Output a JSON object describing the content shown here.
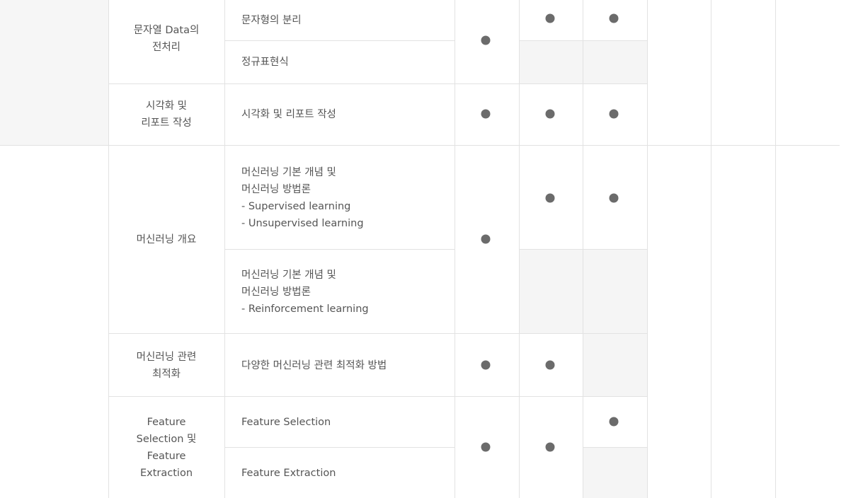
{
  "table": {
    "groups": [
      {
        "category": "문자열 Data의\n전처리",
        "merged_marks": [
          true
        ],
        "rows": [
          {
            "topic": "문자형의 분리",
            "marks": [
              true,
              true
            ]
          },
          {
            "topic": "정규표현식",
            "marks": [
              false,
              false
            ]
          }
        ]
      },
      {
        "category": "시각화 및\n리포트 작성",
        "merged_marks": [
          true
        ],
        "rows": [
          {
            "topic": "시각화 및 리포트 작성",
            "marks": [
              true,
              true
            ]
          }
        ]
      },
      {
        "category": "머신러닝 개요",
        "merged_marks": [
          true
        ],
        "rows": [
          {
            "topic": "머신러닝 기본 개념 및\n머신러닝 방법론\n- Supervised learning\n- Unsupervised learning",
            "marks": [
              true,
              true
            ]
          },
          {
            "topic": "머신러닝 기본 개념 및\n머신러닝 방법론\n- Reinforcement learning",
            "marks": [
              false,
              false
            ]
          }
        ]
      },
      {
        "category": "머신러닝 관련\n최적화",
        "merged_marks": [
          true,
          true
        ],
        "rows": [
          {
            "topic": "다양한 머신러닝 관련 최적화 방법",
            "marks": [
              false
            ]
          }
        ]
      },
      {
        "category": "Feature\nSelection 및\nFeature\nExtraction",
        "merged_marks": [
          true,
          true
        ],
        "rows": [
          {
            "topic": "Feature Selection",
            "marks": [
              true
            ]
          },
          {
            "topic": "Feature Extraction",
            "marks": [
              false
            ]
          }
        ]
      }
    ]
  }
}
